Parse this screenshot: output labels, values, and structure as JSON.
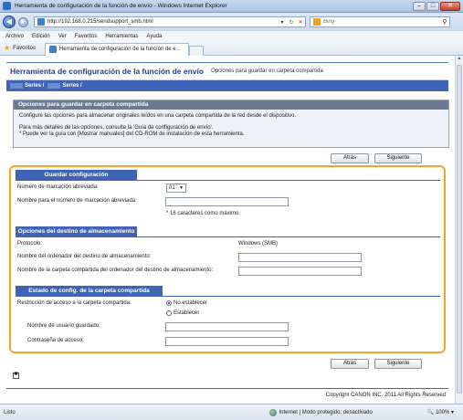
{
  "window": {
    "title": "Herramienta de configuración de la función de envío - Windows Internet Explorer",
    "minimize": "–",
    "maximize": "□",
    "close": "✕"
  },
  "address": {
    "url": "http://192.168.0.215/sendsupport_smb.html",
    "search_placeholder": "Bing"
  },
  "menu": [
    "Archivo",
    "Edición",
    "Ver",
    "Favoritos",
    "Herramientas",
    "Ayuda"
  ],
  "favorites": {
    "label": "Favoritos",
    "tab_title": "Herramienta de configuración de la función de e..."
  },
  "page": {
    "title": "Herramienta de configuración de la función de envío",
    "subtitle": "Opciones para guardar en carpeta compartida",
    "series_1": "Series /",
    "series_2": "Series /"
  },
  "info": {
    "heading": "Opciones para guardar en carpeta compartida",
    "line1": "Configure las opciones para almacenar originales leídos en una carpeta compartida de la red desde el dispositivo.",
    "line2": "Para más detalles de las opciones, consulte la 'Guía de configuración de envío'.",
    "line3": "* Puede ver la guía con [Mostrar manuales] del CD-ROM de instalación de esta herramienta."
  },
  "buttons": {
    "back": "Atrás",
    "next": "Siguiente"
  },
  "save_config": {
    "heading": "Guardar configuración",
    "abbr_dial_label": "Número de marcación abreviada:",
    "abbr_dial_value": "01",
    "name_label": "Nombre para el número de marcación abreviada:",
    "name_hint": "* 16 caracteres como máximo"
  },
  "storage": {
    "heading": "Opciones del destino de almacenamiento",
    "protocol_label": "Protocolo:",
    "protocol_value": "Windows (SMB)",
    "computer_label": "Nombre del ordenador del destino de almacenamiento:",
    "folder_label": "Nombre de la carpeta compartida del ordenador del destino de almacenamiento:"
  },
  "shared_folder": {
    "heading": "Estado de config. de la carpeta compartida",
    "restriction_label": "Restricción de acceso a la carpeta compartida:",
    "opt_no": "No establecer",
    "opt_yes": "Establecer",
    "user_label": "Nombre de usuario guardado:",
    "password_label": "Contraseña de acceso:"
  },
  "footer": {
    "copyright": "Copyright CANON INC. 2011 All Rights Reserved"
  },
  "status": {
    "left": "Listo",
    "zone": "Internet | Modo protegido: desactivado",
    "zoom": "100%"
  }
}
